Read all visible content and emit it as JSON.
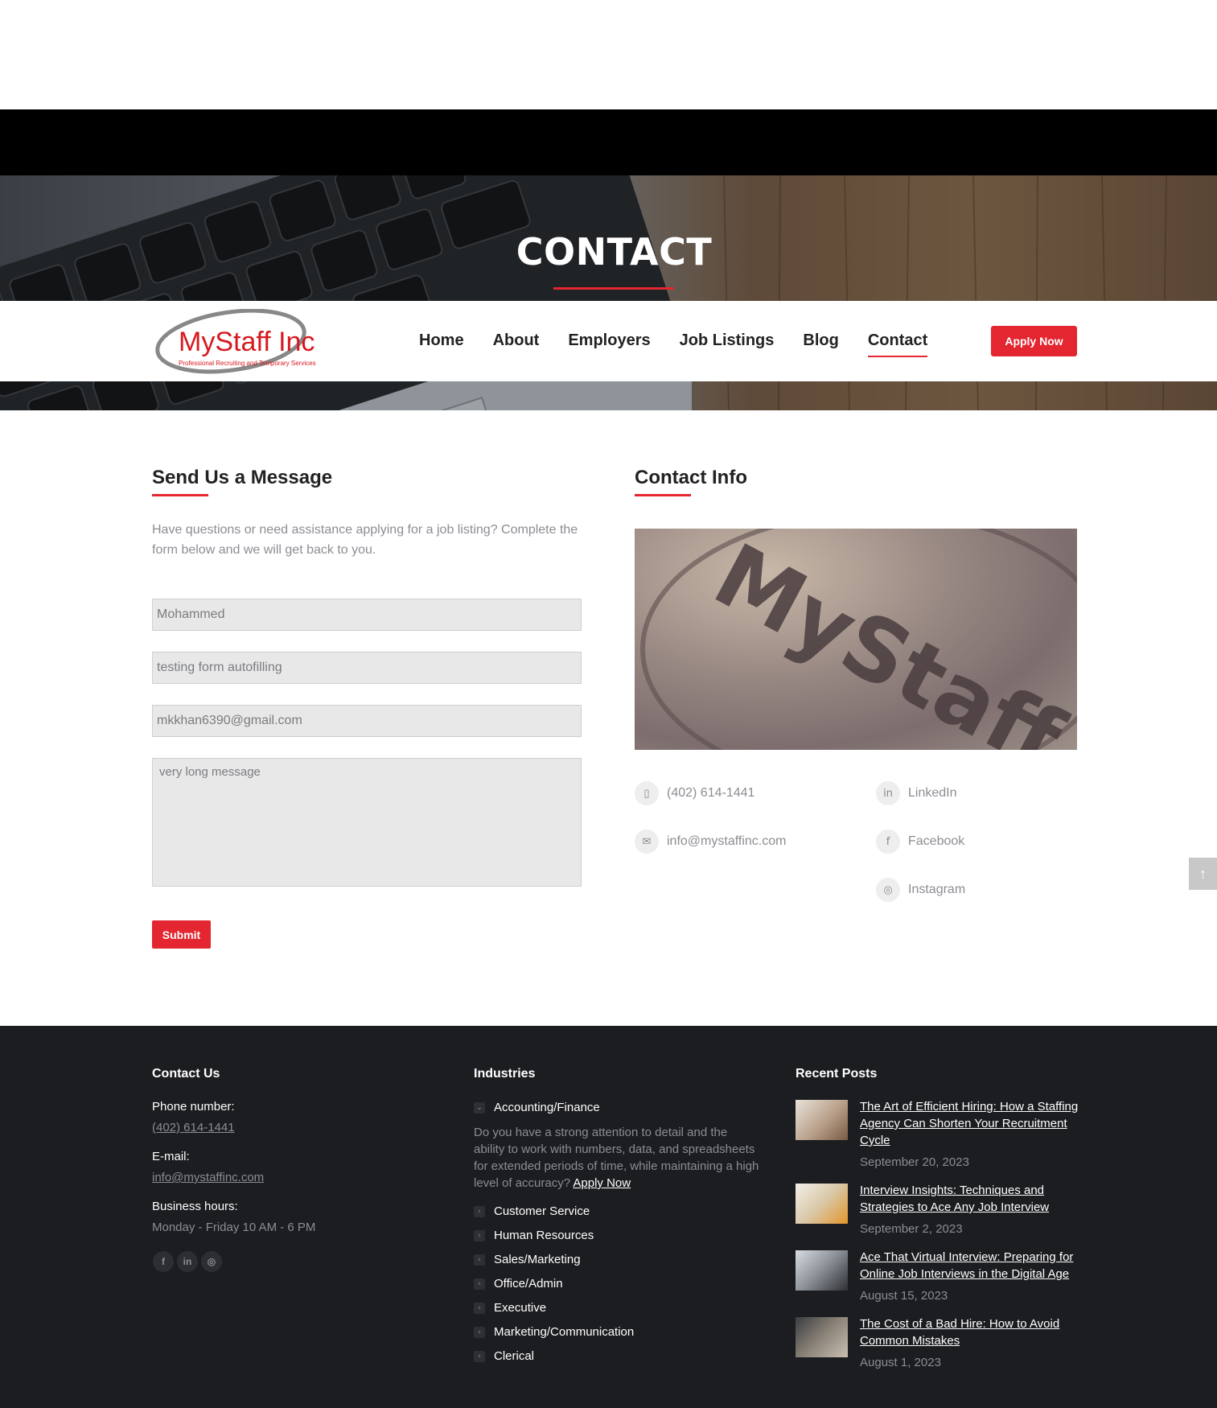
{
  "hero": {
    "title": "CONTACT"
  },
  "logo": {
    "name": "MyStaff Inc",
    "tagline": "Professional Recruiting and Temporary Services"
  },
  "nav": {
    "items": [
      "Home",
      "About",
      "Employers",
      "Job Listings",
      "Blog",
      "Contact"
    ],
    "active": "Contact",
    "apply_label": "Apply Now"
  },
  "form": {
    "title": "Send Us a Message",
    "intro": "Have questions or need assistance applying for a job listing? Complete the form below and we will get back to you.",
    "name_value": "Mohammed",
    "subject_value": "testing form autofilling",
    "email_value": "mkkhan6390@gmail.com",
    "message_value": "very long message",
    "submit_label": "Submit"
  },
  "contact_info": {
    "title": "Contact Info",
    "image_text": "MyStaff",
    "phone": "(402) 614-1441",
    "email": "info@mystaffinc.com",
    "socials": [
      "LinkedIn",
      "Facebook",
      "Instagram"
    ]
  },
  "footer": {
    "contact": {
      "title": "Contact Us",
      "phone_label": "Phone number:",
      "phone": "(402) 614-1441",
      "email_label": "E-mail:",
      "email": "info@mystaffinc.com",
      "hours_label": "Business hours:",
      "hours": "Monday - Friday 10 AM - 6 PM"
    },
    "industries": {
      "title": "Industries",
      "first": "Accounting/Finance",
      "first_desc": "Do you have a strong attention to detail and the ability to work with numbers, data, and spreadsheets for extended periods of time, while maintaining a high level of accuracy?",
      "first_link": "Apply Now",
      "items": [
        "Customer Service",
        "Human Resources",
        "Sales/Marketing",
        "Office/Admin",
        "Executive",
        "Marketing/Communication",
        "Clerical"
      ]
    },
    "posts": {
      "title": "Recent Posts",
      "items": [
        {
          "title": "The Art of Efficient Hiring: How a Staffing Agency Can Shorten Your Recruitment Cycle",
          "date": "September 20, 2023"
        },
        {
          "title": "Interview Insights: Techniques and Strategies to Ace Any Job Interview",
          "date": "September 2, 2023"
        },
        {
          "title": "Ace That Virtual Interview: Preparing for Online Job Interviews in the Digital Age",
          "date": "August 15, 2023"
        },
        {
          "title": "The Cost of a Bad Hire: How to Avoid Common Mistakes",
          "date": "August 1, 2023"
        }
      ]
    }
  },
  "colors": {
    "accent": "#e3262f",
    "footer_bg": "#1c1d21",
    "muted": "#8b8d93"
  }
}
